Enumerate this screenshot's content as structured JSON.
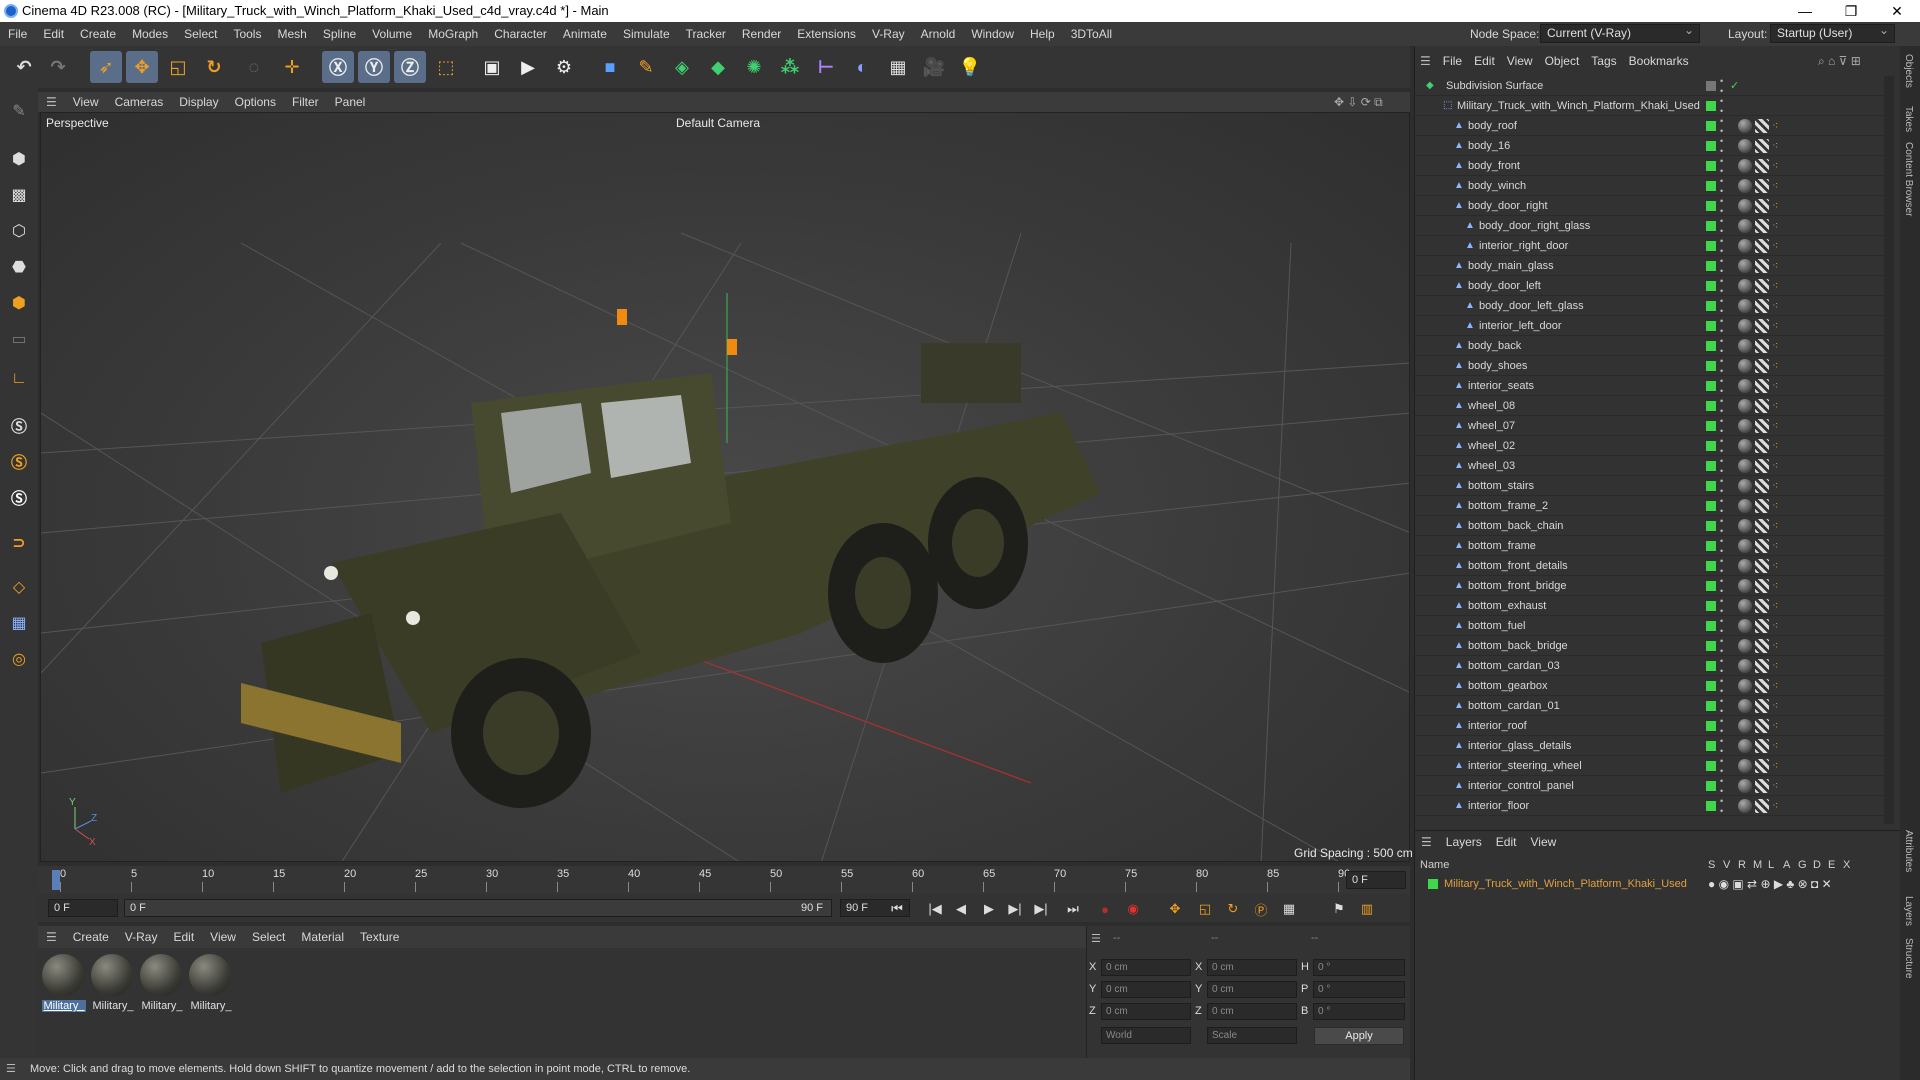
{
  "window": {
    "title": "Cinema 4D R23.008 (RC) - [Military_Truck_with_Winch_Platform_Khaki_Used_c4d_vray.c4d *] - Main",
    "minimize": "—",
    "maximize": "❐",
    "close": "✕"
  },
  "menubar": [
    "File",
    "Edit",
    "Create",
    "Modes",
    "Select",
    "Tools",
    "Mesh",
    "Spline",
    "Volume",
    "MoGraph",
    "Character",
    "Animate",
    "Simulate",
    "Tracker",
    "Render",
    "Extensions",
    "V-Ray",
    "Arnold",
    "Window",
    "Help",
    "3DToAll"
  ],
  "nodespace": {
    "label": "Node Space:",
    "value": "Current (V-Ray)"
  },
  "layout": {
    "label": "Layout:",
    "value": "Startup (User)"
  },
  "viewport_menu": [
    "View",
    "Cameras",
    "Display",
    "Options",
    "Filter",
    "Panel"
  ],
  "viewport": {
    "name": "Perspective",
    "camera": "Default Camera",
    "grid_spacing": "Grid Spacing : 500 cm"
  },
  "timeline": {
    "ticks": [
      "0",
      "5",
      "10",
      "15",
      "20",
      "25",
      "30",
      "35",
      "40",
      "45",
      "50",
      "55",
      "60",
      "65",
      "70",
      "75",
      "80",
      "85",
      "90"
    ],
    "end_field": "0 F"
  },
  "timectrl": {
    "start": "0 F",
    "current": "0 F",
    "range_end": "90 F",
    "end": "90 F"
  },
  "material_menu": [
    "Create",
    "V-Ray",
    "Edit",
    "View",
    "Select",
    "Material",
    "Texture"
  ],
  "materials": [
    {
      "label": "Military_"
    },
    {
      "label": "Military_"
    },
    {
      "label": "Military_"
    },
    {
      "label": "Military_"
    }
  ],
  "coords": {
    "header": [
      "--",
      "--",
      "--"
    ],
    "rows": [
      {
        "a": "X",
        "av": "0 cm",
        "b": "X",
        "bv": "0 cm",
        "c": "H",
        "cv": "0 °"
      },
      {
        "a": "Y",
        "av": "0 cm",
        "b": "Y",
        "bv": "0 cm",
        "c": "P",
        "cv": "0 °"
      },
      {
        "a": "Z",
        "av": "0 cm",
        "b": "Z",
        "bv": "0 cm",
        "c": "B",
        "cv": "0 °"
      }
    ],
    "world": "World",
    "scale": "Scale",
    "apply": "Apply"
  },
  "status": "Move: Click and drag to move elements. Hold down SHIFT to quantize movement / add to the selection in point mode, CTRL to remove.",
  "object_menu": [
    "File",
    "Edit",
    "View",
    "Object",
    "Tags",
    "Bookmarks"
  ],
  "objects": [
    {
      "name": "Subdivision Surface",
      "level": 0
    },
    {
      "name": "Military_Truck_with_Winch_Platform_Khaki_Used",
      "level": 1
    },
    {
      "name": "body_roof",
      "level": 2
    },
    {
      "name": "body_16",
      "level": 2
    },
    {
      "name": "body_front",
      "level": 2
    },
    {
      "name": "body_winch",
      "level": 2
    },
    {
      "name": "body_door_right",
      "level": 2
    },
    {
      "name": "body_door_right_glass",
      "level": 3
    },
    {
      "name": "interior_right_door",
      "level": 3
    },
    {
      "name": "body_main_glass",
      "level": 2
    },
    {
      "name": "body_door_left",
      "level": 2
    },
    {
      "name": "body_door_left_glass",
      "level": 3
    },
    {
      "name": "interior_left_door",
      "level": 3
    },
    {
      "name": "body_back",
      "level": 2
    },
    {
      "name": "body_shoes",
      "level": 2
    },
    {
      "name": "interior_seats",
      "level": 2
    },
    {
      "name": "wheel_08",
      "level": 2
    },
    {
      "name": "wheel_07",
      "level": 2
    },
    {
      "name": "wheel_02",
      "level": 2
    },
    {
      "name": "wheel_03",
      "level": 2
    },
    {
      "name": "bottom_stairs",
      "level": 2
    },
    {
      "name": "bottom_frame_2",
      "level": 2
    },
    {
      "name": "bottom_back_chain",
      "level": 2
    },
    {
      "name": "bottom_frame",
      "level": 2
    },
    {
      "name": "bottom_front_details",
      "level": 2
    },
    {
      "name": "bottom_front_bridge",
      "level": 2
    },
    {
      "name": "bottom_exhaust",
      "level": 2
    },
    {
      "name": "bottom_fuel",
      "level": 2
    },
    {
      "name": "bottom_back_bridge",
      "level": 2
    },
    {
      "name": "bottom_cardan_03",
      "level": 2
    },
    {
      "name": "bottom_gearbox",
      "level": 2
    },
    {
      "name": "bottom_cardan_01",
      "level": 2
    },
    {
      "name": "interior_roof",
      "level": 2
    },
    {
      "name": "interior_glass_details",
      "level": 2
    },
    {
      "name": "interior_steering_wheel",
      "level": 2
    },
    {
      "name": "interior_control_panel",
      "level": 2
    },
    {
      "name": "interior_floor",
      "level": 2
    }
  ],
  "layers_menu": [
    "Layers",
    "Edit",
    "View"
  ],
  "layers_header": {
    "name": "Name",
    "cols": [
      "S",
      "V",
      "R",
      "M",
      "L",
      "A",
      "G",
      "D",
      "E",
      "X"
    ]
  },
  "layer": {
    "name": "Military_Truck_with_Winch_Platform_Khaki_Used"
  },
  "side_tabs": [
    "Objects",
    "Takes",
    "Content Browser",
    "Attributes",
    "Layers",
    "Structure"
  ],
  "colors": {
    "accent": "#4d6f9c",
    "green": "#3fd84a",
    "layer_orange": "#e0a040"
  }
}
